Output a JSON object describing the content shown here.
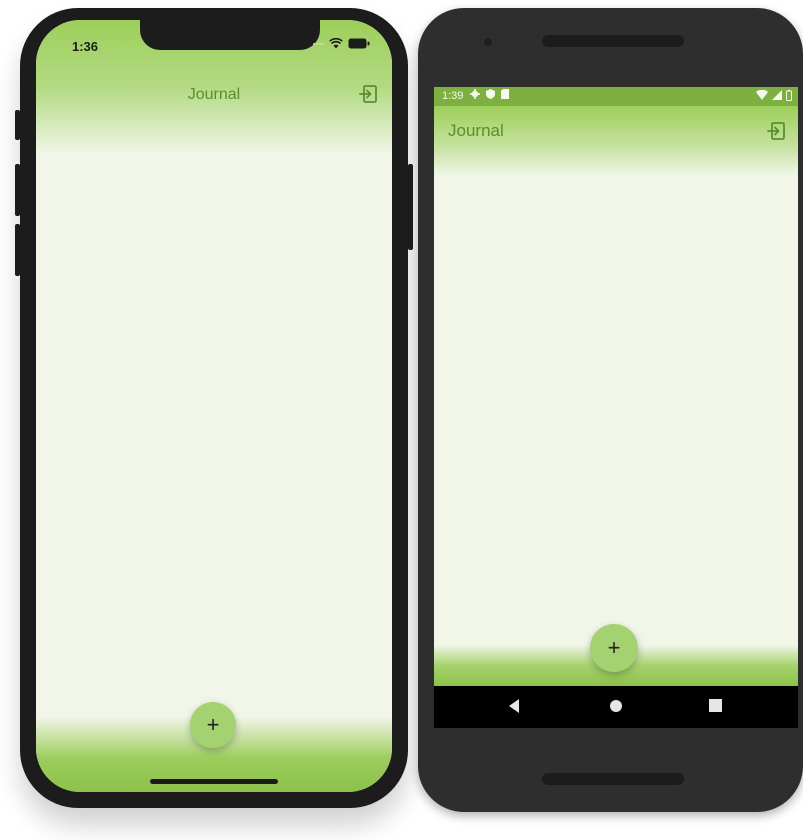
{
  "ios": {
    "time": "1:36",
    "title": "Journal",
    "fab_label": "+"
  },
  "android": {
    "time": "1:39",
    "title": "Journal",
    "fab_label": "+"
  },
  "colors": {
    "accent": "#9ccf5a",
    "title_text": "#5b8f2d",
    "background": "#f1f6e8",
    "fab": "#a4d271"
  },
  "icons": [
    "logout-icon",
    "wifi-icon",
    "battery-icon",
    "signal-icon",
    "back-icon",
    "home-icon",
    "recents-icon"
  ]
}
